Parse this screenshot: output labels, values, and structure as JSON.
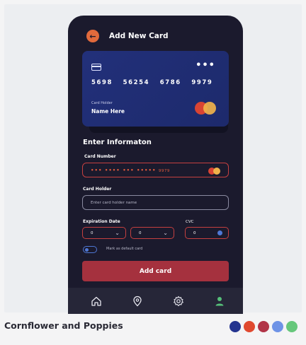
{
  "header": {
    "title": "Add New Card",
    "back_icon": "arrow-left-icon"
  },
  "card": {
    "number_groups": [
      "5698",
      "56254",
      "6786",
      "9979"
    ],
    "holder_label": "Card Holder",
    "holder_name": "Name Here",
    "more_icon": "•••"
  },
  "form": {
    "section_title": "Enter Informaton",
    "card_number_label": "Card Number",
    "card_number_masked": "••• •••• ••• •••••",
    "card_number_tail": "9979",
    "card_holder_label": "Card Holder",
    "card_holder_placeholder": "Enter card holder name",
    "expiration_label": "Expiration Date",
    "exp_month": "0",
    "exp_year": "0",
    "cvc_label": "CVC",
    "cvc_value": "0",
    "default_card_label": "Mark as default card",
    "submit_label": "Add card"
  },
  "nav": {
    "items": [
      "home-icon",
      "location-icon",
      "settings-icon",
      "profile-icon"
    ],
    "active": "profile-icon"
  },
  "footer": {
    "title": "Cornflower and Poppies",
    "palette": [
      "#24348f",
      "#e0492f",
      "#b13447",
      "#6e93e6",
      "#66c77b"
    ]
  },
  "colors": {
    "background": "#1b1a2d",
    "accent": "#a5313e",
    "card": "#22307a",
    "error": "#c54040"
  }
}
